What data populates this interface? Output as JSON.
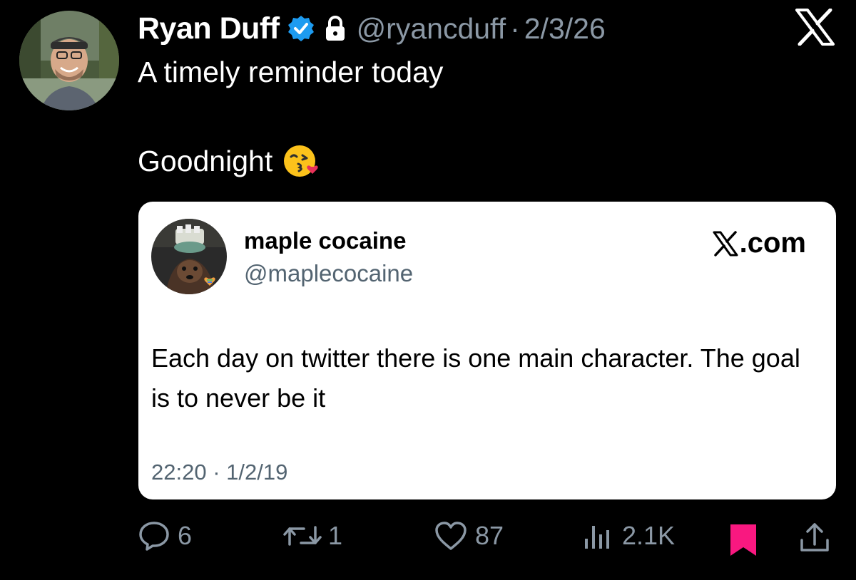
{
  "tweet": {
    "author_name": "Ryan Duff",
    "author_handle": "@ryancduff",
    "separator": "·",
    "date": "2/3/26",
    "text_line1": "A timely reminder today",
    "text_line2": "Goodnight",
    "emoji": "face-blowing-a-kiss"
  },
  "quoted": {
    "author_name": "maple cocaine",
    "author_handle": "@maplecocaine",
    "source_label": ".com",
    "text": "Each day on twitter there is one main character. The goal is to never be it",
    "timestamp": "22:20 · 1/2/19"
  },
  "actions": {
    "replies": "6",
    "reposts": "1",
    "likes": "87",
    "views": "2.1K"
  },
  "colors": {
    "background": "#000000",
    "muted": "#8b98a5",
    "verified": "#1d9bf0",
    "bookmark": "#f91880"
  }
}
